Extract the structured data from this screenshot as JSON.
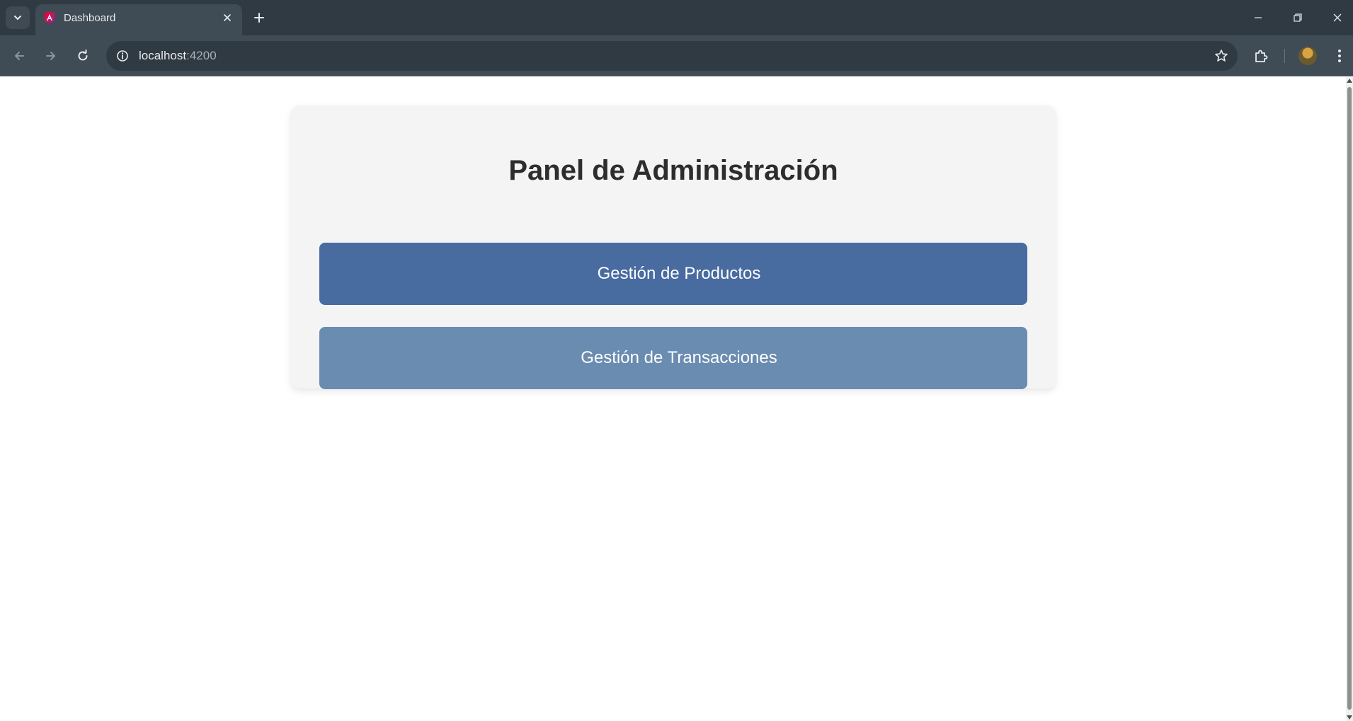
{
  "browser": {
    "tab": {
      "title": "Dashboard"
    },
    "address_bar": {
      "host": "localhost",
      "port": ":4200"
    }
  },
  "page": {
    "title": "Panel de Administración",
    "buttons": {
      "productos_label": "Gestión de Productos",
      "transacciones_label": "Gestión de Transacciones"
    }
  },
  "colors": {
    "button_primary": "#486ba0",
    "button_secondary": "#6a8cb1",
    "card_background": "#f4f4f4",
    "title_text": "#2d2d2d"
  }
}
